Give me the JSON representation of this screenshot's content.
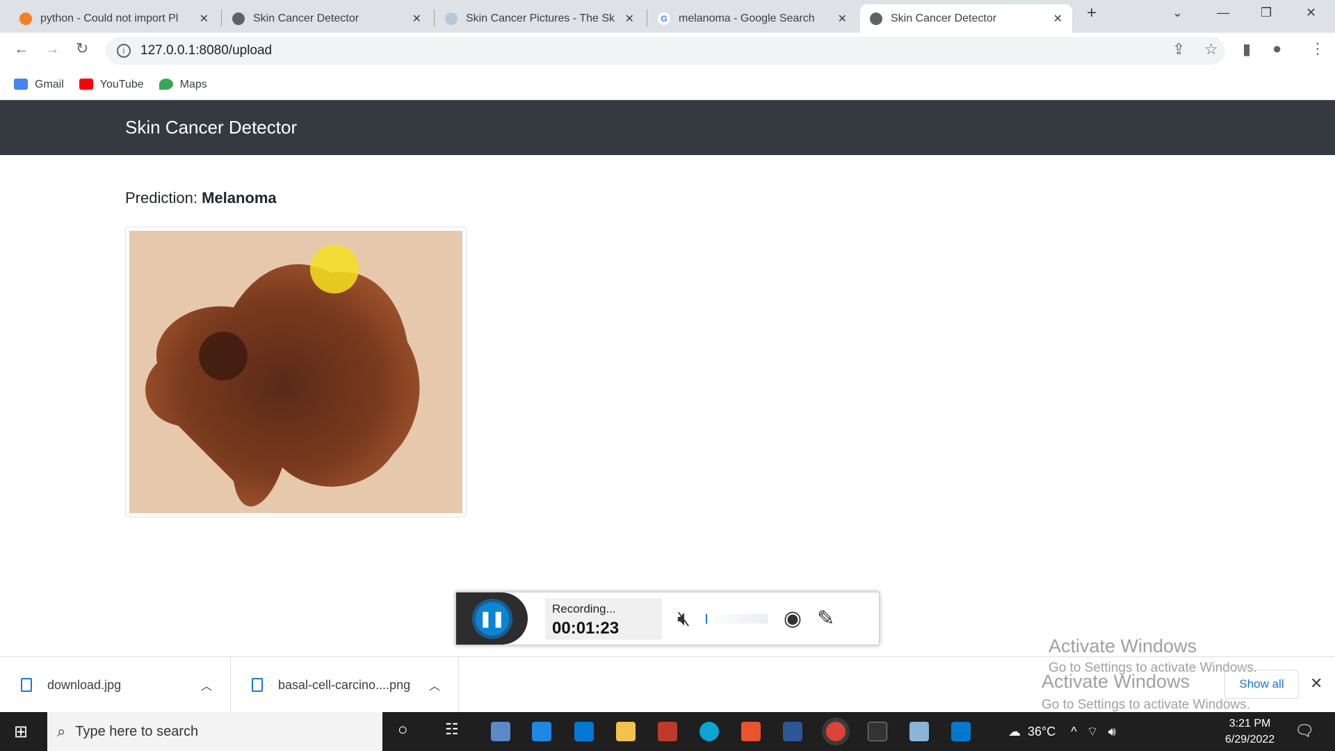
{
  "browser": {
    "tabs": [
      {
        "title": "python - Could not import Pl",
        "icon": "stackoverflow-icon"
      },
      {
        "title": "Skin Cancer Detector",
        "icon": "globe-icon"
      },
      {
        "title": "Skin Cancer Pictures - The Sk",
        "icon": "skincancer-org-icon"
      },
      {
        "title": "melanoma - Google Search",
        "icon": "google-icon"
      },
      {
        "title": "Skin Cancer Detector",
        "icon": "globe-icon",
        "active": true
      }
    ],
    "url": "127.0.0.1:8080/upload",
    "bookmarks": [
      {
        "label": "Gmail",
        "color": "#4285f4"
      },
      {
        "label": "YouTube",
        "color": "#ff0000"
      },
      {
        "label": "Maps",
        "color": "#34a853"
      }
    ]
  },
  "page": {
    "brand": "Skin Cancer Detector",
    "prediction_label": "Prediction:",
    "prediction_value": "Melanoma"
  },
  "recorder": {
    "status": "Recording...",
    "time": "00:01:23"
  },
  "downloads": {
    "items": [
      "download.jpg",
      "basal-cell-carcino....png"
    ],
    "show_all": "Show all"
  },
  "watermark": {
    "title": "Activate Windows",
    "subtitle": "Go to Settings to activate Windows."
  },
  "taskbar": {
    "search_placeholder": "Type here to search",
    "temperature": "36°C",
    "time": "3:21 PM",
    "date": "6/29/2022"
  }
}
